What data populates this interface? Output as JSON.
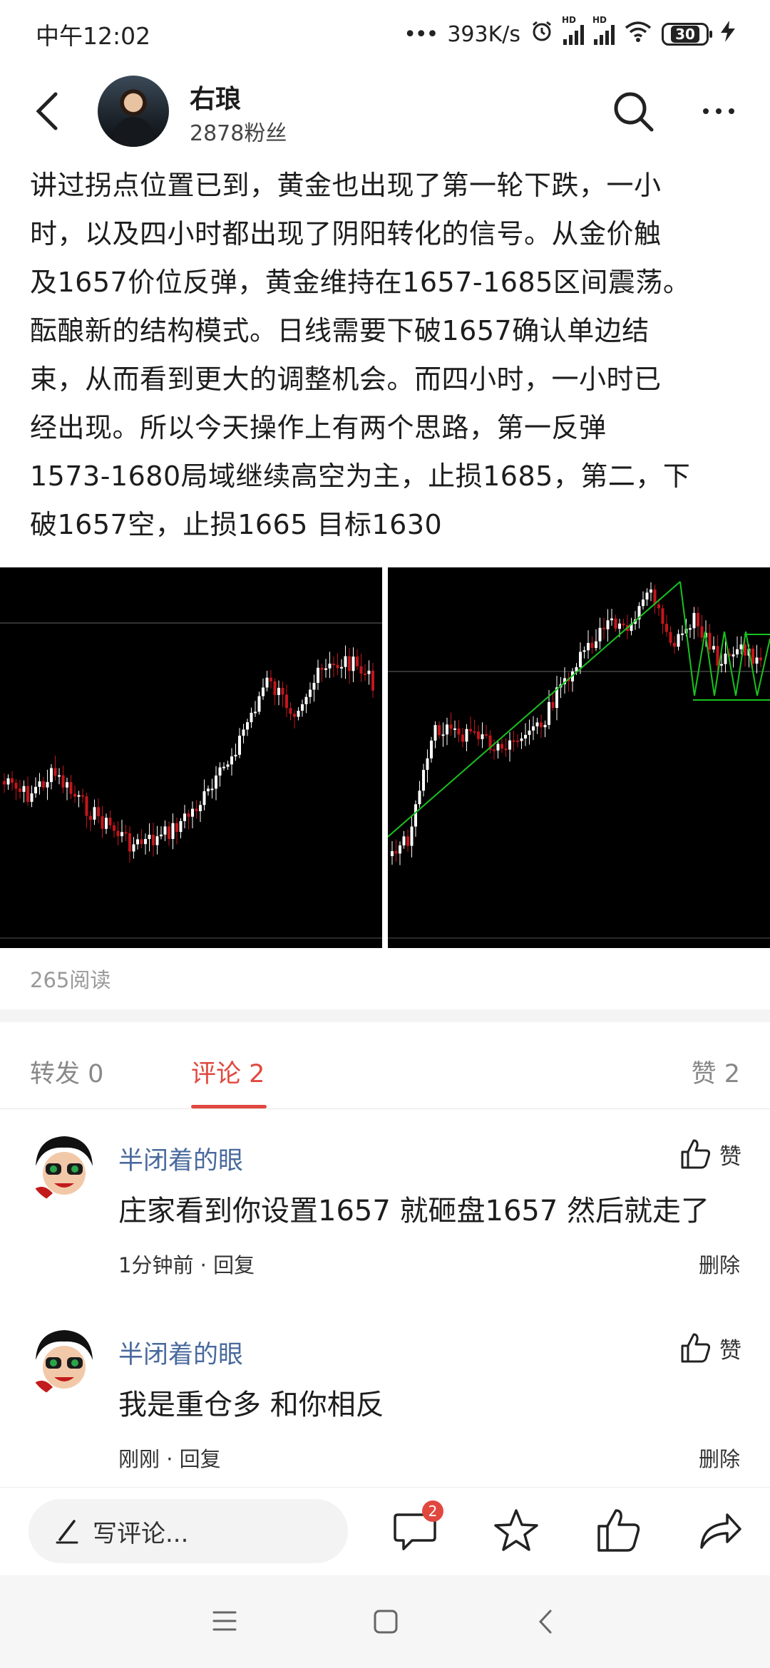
{
  "status_bar": {
    "time": "中午12:02",
    "network_speed": "393K/s",
    "hd_label": "HD",
    "battery": "30",
    "icons": [
      "dots-icon",
      "alarm-icon",
      "signal-icon",
      "signal-icon",
      "wifi-icon",
      "battery-icon",
      "charging-icon"
    ]
  },
  "header": {
    "author_name": "右琅",
    "fans": "2878粉丝",
    "icons": [
      "back-arrow-icon",
      "search-icon",
      "more-icon"
    ]
  },
  "post": {
    "lines": [
      "讲过拐点位置已到，黄金也出现了第一轮下跌，一小",
      "时，以及四小时都出现了阴阳转化的信号。从金价触",
      "及1657价位反弹，黄金维持在1657-1685区间震荡。",
      "酝酿新的结构模式。日线需要下破1657确认单边结",
      "束，从而看到更大的调整机会。而四小时，一小时已",
      "经出现。所以今天操作上有两个思路，第一反弹",
      "1573-1680局域继续高空为主，止损1685，第二，下",
      "破1657空，止损1665 目标1630"
    ],
    "reads": "265阅读"
  },
  "charts": {
    "colors": {
      "background": "#000000",
      "bull": "#ffffff",
      "bear": "#c4161c",
      "trend": "#19c21f",
      "level": "#666666"
    }
  },
  "tabs": {
    "repost": "转发 0",
    "comment": "评论 2",
    "likes": "赞 2",
    "active_color": "#e0483f"
  },
  "comments": [
    {
      "name": "半闭着的眼",
      "like_label": "赞",
      "text": "庄家看到你设置1657 就砸盘1657 然后就走了",
      "meta": "1分钟前 · 回复",
      "delete": "删除"
    },
    {
      "name": "半闭着的眼",
      "like_label": "赞",
      "text": "我是重仓多 和你相反",
      "meta": "刚刚 · 回复",
      "delete": "删除"
    }
  ],
  "action_bar": {
    "write_placeholder": "写评论...",
    "comment_badge": "2",
    "icons": [
      "pencil-icon",
      "comment-bubble-icon",
      "star-icon",
      "thumbs-up-icon",
      "share-icon"
    ]
  },
  "nav_bar": {
    "icons": [
      "menu-icon",
      "home-square-icon",
      "back-triangle-icon"
    ]
  }
}
